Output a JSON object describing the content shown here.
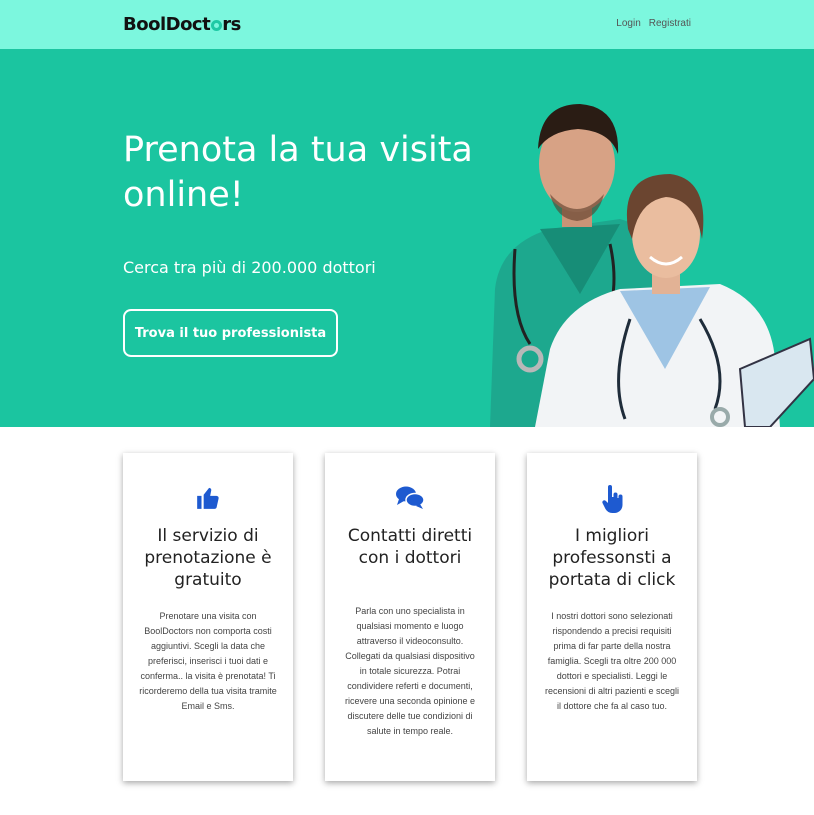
{
  "header": {
    "logo_text": "BoolDoct",
    "logo_suffix": "rs",
    "nav": {
      "login": "Login",
      "register": "Registrati"
    }
  },
  "hero": {
    "title": "Prenota la tua visita online!",
    "subtitle": "Cerca tra più di 200.000 dottori",
    "cta": "Trova il tuo professionista"
  },
  "features": [
    {
      "icon": "thumbs-up-icon",
      "title": "Il servizio di prenotazione è gratuito",
      "text": "Prenotare una visita con BoolDoctors non comporta costi aggiuntivi. Scegli la data che preferisci, inserisci i tuoi dati e conferma.. la visita è prenotata! Ti ricorderemo della tua visita tramite Email e Sms."
    },
    {
      "icon": "chat-bubbles-icon",
      "title": "Contatti diretti con i dottori",
      "text": "Parla con uno specialista in qualsiasi momento e luogo attraverso il videoconsulto. Collegati da qualsiasi dispositivo in totale sicurezza. Potrai condividere referti e documenti, ricevere una seconda opinione e discutere delle tue condizioni di salute in tempo reale."
    },
    {
      "icon": "pointing-hand-icon",
      "title": "I migliori professonsti a portata di click",
      "text": "I nostri dottori sono selezionati rispondendo a precisi requisiti prima di far parte della nostra famiglia. Scegli tra oltre 200 000 dottori e specialisti. Leggi le recensioni di altri pazienti e scegli il dottore che fa al caso tuo."
    }
  ],
  "colors": {
    "header_bg": "#7cf7de",
    "hero_bg": "#1bc5a0",
    "accent_icon": "#1e5ad0"
  }
}
